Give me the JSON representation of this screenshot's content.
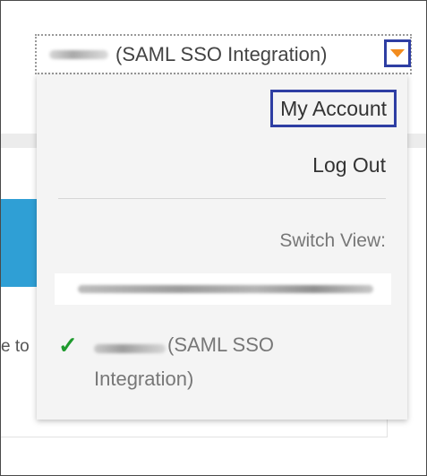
{
  "account_menu": {
    "trigger_label": "(SAML SSO Integration)",
    "caret_icon": "caret-down-icon",
    "caret_color": "#f28c1e",
    "items": {
      "my_account": "My Account",
      "log_out": "Log Out"
    },
    "switch_view_label": "Switch View:",
    "current_view": {
      "check_icon": "checkmark-icon",
      "line1": "(SAML SSO",
      "line2": "Integration)"
    }
  },
  "background": {
    "partial_text": "e to"
  },
  "colors": {
    "highlight_border": "#2e3ea3",
    "check": "#1f9a2e",
    "blue_block": "#2f9fd5"
  }
}
